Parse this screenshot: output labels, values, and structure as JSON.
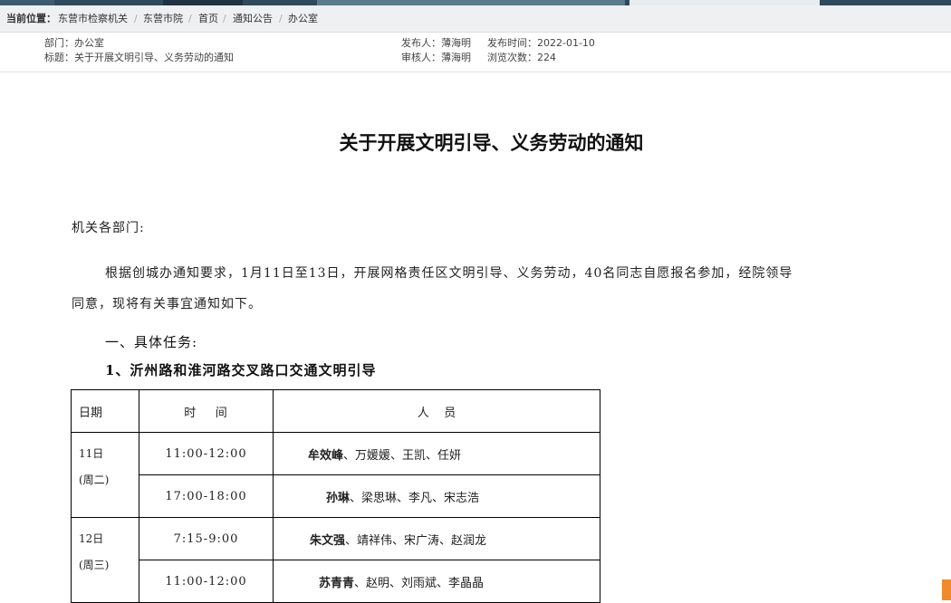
{
  "breadcrumb": {
    "label": "当前位置：",
    "items": [
      "东营市检察机关",
      "东营市院",
      "首页",
      "通知公告",
      "办公室"
    ]
  },
  "meta": {
    "department": "部门：办公室",
    "title_line": "标题：关于开展文明引导、义务劳动的通知",
    "publisher": "发布人：薄海明",
    "publish_time": "发布时间：2022-01-10",
    "reviewer": "审核人：薄海明",
    "views": "浏览次数：224"
  },
  "article": {
    "title": "关于开展文明引导、义务劳动的通知",
    "salutation": "机关各部门:",
    "para1_line1": "根据创城办通知要求，1月11日至13日，开展网格责任区文明引导、义务劳动，40名同志自愿报名参加，经院领导",
    "para1_line2": "同意，现将有关事宜通知如下。",
    "section1": "一、具体任务:",
    "subsection1": "1、沂州路和淮河路交叉路口交通文明引导"
  },
  "table": {
    "headers": [
      "日期",
      "时    间",
      "人    员"
    ],
    "days": [
      {
        "date": "11日",
        "weekday": "(周二)",
        "rows": [
          {
            "time": "11:00-12:00",
            "lead": "牟效峰",
            "rest": "、万媛媛、王凯、任妍"
          },
          {
            "time": "17:00-18:00",
            "lead": "孙琳",
            "rest": "、梁思琳、李凡、宋志浩"
          }
        ]
      },
      {
        "date": "12日",
        "weekday": "(周三)",
        "rows": [
          {
            "time": "7:15-9:00",
            "lead": "朱文强",
            "rest": "、靖祥伟、宋广涛、赵润龙"
          },
          {
            "time": "11:00-12:00",
            "lead": "苏青青",
            "rest": "、赵明、刘雨斌、李晶晶"
          }
        ]
      }
    ]
  },
  "colors": {
    "topbar": "#2f4a5c",
    "crumb_bg": "#eef0f2",
    "accent_corner": "#f08a2e"
  }
}
